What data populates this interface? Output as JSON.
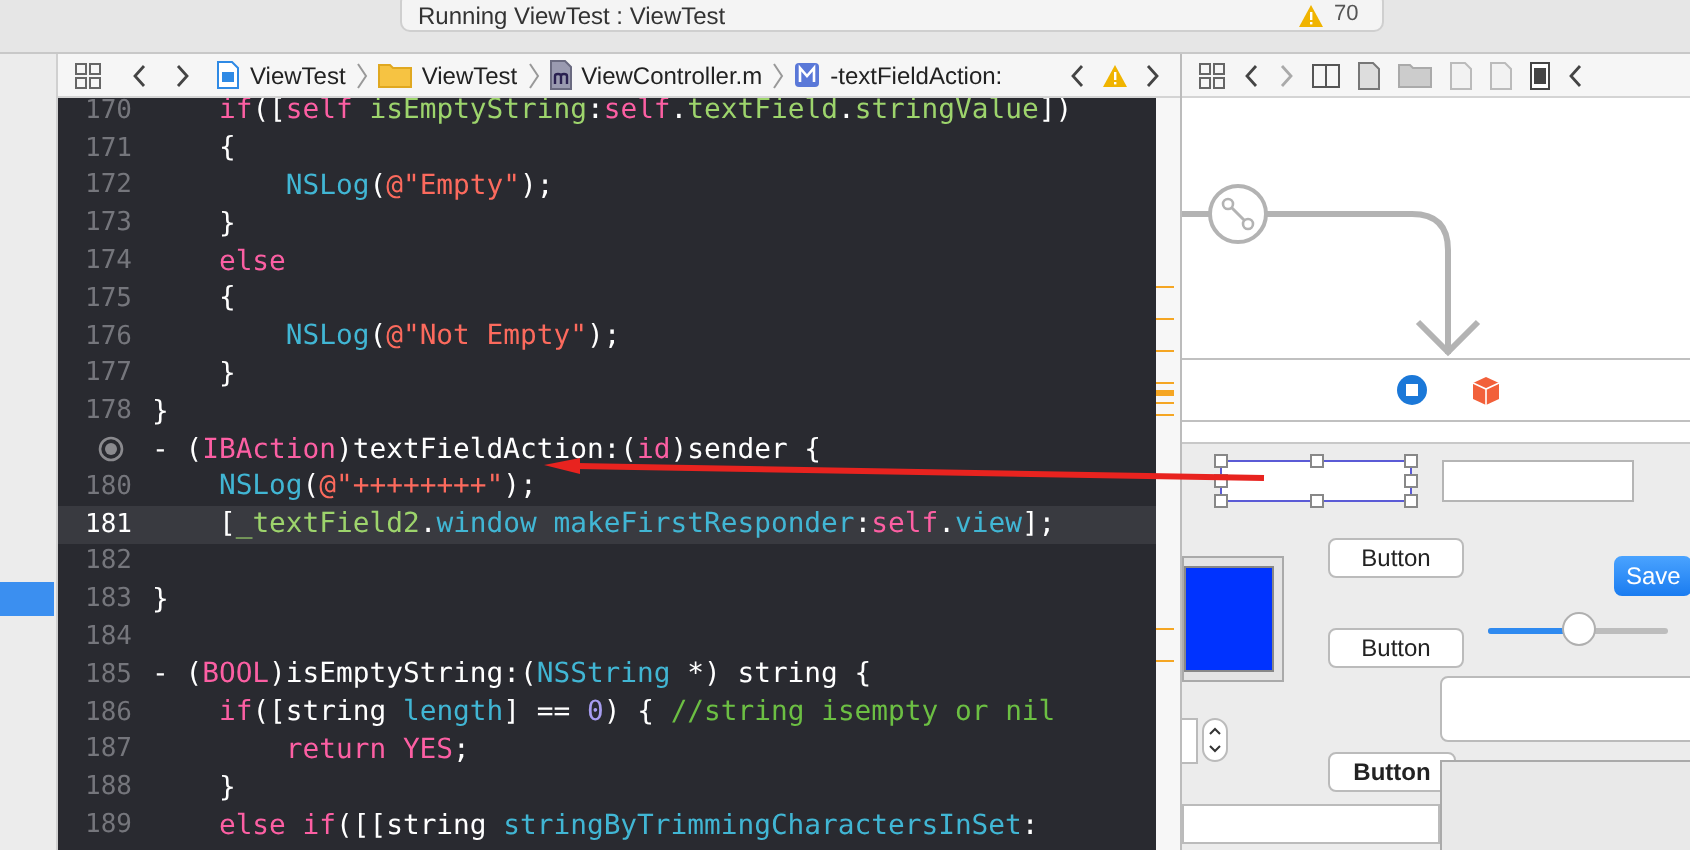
{
  "title_bar": {
    "activity": "Running ViewTest : ViewTest",
    "warning_count": "70"
  },
  "editor_jump_bar": {
    "path": [
      {
        "kind": "project",
        "label": "ViewTest"
      },
      {
        "kind": "folder",
        "label": "ViewTest"
      },
      {
        "kind": "m-file",
        "label": "ViewController.m"
      },
      {
        "kind": "method",
        "label": "-textFieldAction:"
      }
    ]
  },
  "code": {
    "lines": [
      {
        "kind": "code",
        "number": "170",
        "current": false,
        "tokens": [
          {
            "t": "    if",
            "kind": "keyword"
          },
          {
            "t": "([",
            "kind": "plain"
          },
          {
            "t": "self ",
            "kind": "keyword"
          },
          {
            "t": "isEmptyString",
            "kind": "project"
          },
          {
            "t": ":",
            "kind": "plain"
          },
          {
            "t": "self",
            "kind": "keyword"
          },
          {
            "t": ".",
            "kind": "plain"
          },
          {
            "t": "textField",
            "kind": "project"
          },
          {
            "t": ".",
            "kind": "plain"
          },
          {
            "t": "stringValue",
            "kind": "project"
          },
          {
            "t": "])",
            "kind": "plain"
          }
        ]
      },
      {
        "kind": "code",
        "number": "171",
        "current": false,
        "tokens": [
          {
            "t": "    {",
            "kind": "plain"
          }
        ]
      },
      {
        "kind": "code",
        "number": "172",
        "current": false,
        "tokens": [
          {
            "t": "        NSLog",
            "kind": "function"
          },
          {
            "t": "(",
            "kind": "plain"
          },
          {
            "t": "@\"Empty\"",
            "kind": "string"
          },
          {
            "t": ");",
            "kind": "plain"
          }
        ]
      },
      {
        "kind": "code",
        "number": "173",
        "current": false,
        "tokens": [
          {
            "t": "    }",
            "kind": "plain"
          }
        ]
      },
      {
        "kind": "code",
        "number": "174",
        "current": false,
        "tokens": [
          {
            "t": "    else",
            "kind": "keyword"
          }
        ]
      },
      {
        "kind": "code",
        "number": "175",
        "current": false,
        "tokens": [
          {
            "t": "    {",
            "kind": "plain"
          }
        ]
      },
      {
        "kind": "code",
        "number": "176",
        "current": false,
        "tokens": [
          {
            "t": "        NSLog",
            "kind": "function"
          },
          {
            "t": "(",
            "kind": "plain"
          },
          {
            "t": "@\"Not Empty\"",
            "kind": "string"
          },
          {
            "t": ");",
            "kind": "plain"
          }
        ]
      },
      {
        "kind": "code",
        "number": "177",
        "current": false,
        "tokens": [
          {
            "t": "    }",
            "kind": "plain"
          }
        ]
      },
      {
        "kind": "code",
        "number": "178",
        "current": false,
        "tokens": [
          {
            "t": "}",
            "kind": "plain"
          }
        ]
      },
      {
        "kind": "action",
        "current": false,
        "tokens": [
          {
            "t": "- (",
            "kind": "plain"
          },
          {
            "t": "IBAction",
            "kind": "keyword"
          },
          {
            "t": ")textFieldAction:(",
            "kind": "plain"
          },
          {
            "t": "id",
            "kind": "keyword"
          },
          {
            "t": ")sender {",
            "kind": "plain"
          }
        ]
      },
      {
        "kind": "code",
        "number": "180",
        "current": false,
        "tokens": [
          {
            "t": "    NSLog",
            "kind": "function"
          },
          {
            "t": "(",
            "kind": "plain"
          },
          {
            "t": "@\"++++++++\"",
            "kind": "string"
          },
          {
            "t": ");",
            "kind": "plain"
          }
        ]
      },
      {
        "kind": "code",
        "number": "181",
        "current": true,
        "tokens": [
          {
            "t": "    [",
            "kind": "plain"
          },
          {
            "t": "_textField2",
            "kind": "project"
          },
          {
            "t": ".",
            "kind": "plain"
          },
          {
            "t": "window makeFirstResponder",
            "kind": "function"
          },
          {
            "t": ":",
            "kind": "plain"
          },
          {
            "t": "self",
            "kind": "keyword"
          },
          {
            "t": ".",
            "kind": "plain"
          },
          {
            "t": "view",
            "kind": "function"
          },
          {
            "t": "];",
            "kind": "plain"
          }
        ]
      },
      {
        "kind": "code",
        "number": "182",
        "current": false
      },
      {
        "kind": "code",
        "number": "183",
        "current": false,
        "tokens": [
          {
            "t": "}",
            "kind": "plain"
          }
        ]
      },
      {
        "kind": "code",
        "number": "184",
        "current": false
      },
      {
        "kind": "code",
        "number": "185",
        "current": false,
        "tokens": [
          {
            "t": "- (",
            "kind": "plain"
          },
          {
            "t": "BOOL",
            "kind": "keyword"
          },
          {
            "t": ")isEmptyString:(",
            "kind": "plain"
          },
          {
            "t": "NSString",
            "kind": "function"
          },
          {
            "t": " *) string {",
            "kind": "plain"
          }
        ]
      },
      {
        "kind": "code",
        "number": "186",
        "current": false,
        "tokens": [
          {
            "t": "    if",
            "kind": "keyword"
          },
          {
            "t": "([string ",
            "kind": "plain"
          },
          {
            "t": "length",
            "kind": "function"
          },
          {
            "t": "] == ",
            "kind": "plain"
          },
          {
            "t": "0",
            "kind": "number"
          },
          {
            "t": ") { ",
            "kind": "plain"
          },
          {
            "t": "//string isempty or nil",
            "kind": "comment"
          }
        ]
      },
      {
        "kind": "code",
        "number": "187",
        "current": false,
        "tokens": [
          {
            "t": "        return YES",
            "kind": "keyword"
          },
          {
            "t": ";",
            "kind": "plain"
          }
        ]
      },
      {
        "kind": "code",
        "number": "188",
        "current": false,
        "tokens": [
          {
            "t": "    }",
            "kind": "plain"
          }
        ]
      },
      {
        "kind": "code",
        "number": "189",
        "current": false,
        "tokens": [
          {
            "t": "    else if",
            "kind": "keyword"
          },
          {
            "t": "([[string ",
            "kind": "plain"
          },
          {
            "t": "stringByTrimmingCharactersInSet",
            "kind": "function"
          },
          {
            "t": ":",
            "kind": "plain"
          }
        ]
      }
    ]
  },
  "canvas": {
    "text_fields": [
      {
        "selected": true
      },
      {
        "selected": false
      }
    ],
    "buttons": [
      {
        "label": "Button",
        "default": false
      },
      {
        "label": "Button",
        "default": false
      },
      {
        "label": "Button",
        "default": true
      }
    ],
    "save_button": "Save",
    "slider": {
      "level": 0.5
    }
  }
}
